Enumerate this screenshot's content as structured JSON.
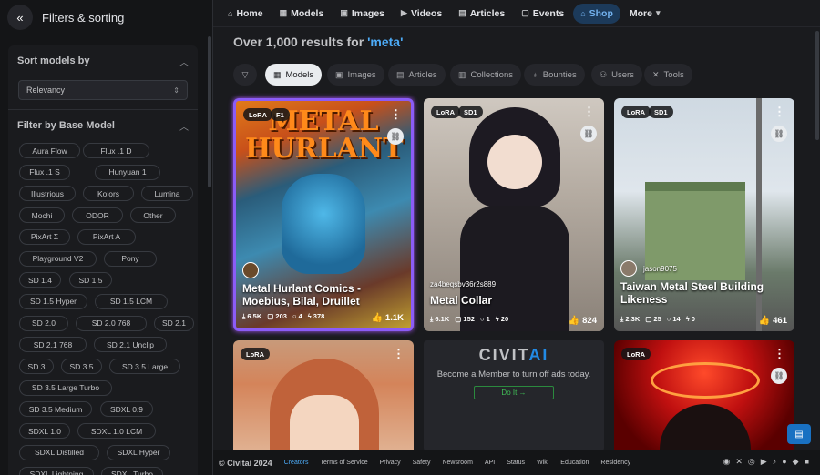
{
  "sidebar": {
    "title": "Filters & sorting",
    "sort_title": "Sort models by",
    "sort_value": "Relevancy",
    "base_model_title": "Filter by Base Model",
    "chips": [
      "Aura Flow",
      "Flux .1 D",
      "Flux .1 S",
      "Hunyuan 1",
      "Illustrious",
      "Kolors",
      "Lumina",
      "Mochi",
      "ODOR",
      "Other",
      "PixArt Σ",
      "PixArt A",
      "Playground V2",
      "Pony",
      "SD 1.4",
      "SD 1.5",
      "SD 1.5 Hyper",
      "SD 1.5 LCM",
      "SD 2.0",
      "SD 2.0 768",
      "SD 2.1",
      "SD 2.1 768",
      "SD 2.1 Unclip",
      "SD 3",
      "SD 3.5",
      "SD 3.5 Large",
      "SD 3.5 Large Turbo",
      "SD 3.5 Medium",
      "SDXL 0.9",
      "SDXL 1.0",
      "SDXL 1.0 LCM",
      "SDXL Distilled",
      "SDXL Hyper",
      "SDXL Lightning",
      "SDXL Turbo"
    ]
  },
  "nav": {
    "items": [
      "Home",
      "Models",
      "Images",
      "Videos",
      "Articles",
      "Events",
      "Shop",
      "More"
    ],
    "active": "Shop"
  },
  "results": {
    "prefix": "Over 1,000 results for ",
    "query": "'meta'"
  },
  "filters": [
    "Models",
    "Images",
    "Articles",
    "Collections",
    "Bounties",
    "Users",
    "Tools"
  ],
  "cards": [
    {
      "badges": [
        "LoRA",
        "F1"
      ],
      "title": "Metal Hurlant Comics - Moebius, Bilal, Druillet",
      "user": "",
      "stats": [
        "6.5K",
        "203",
        "4",
        "378"
      ],
      "likes": "1.1K"
    },
    {
      "badges": [
        "LoRA",
        "SD1"
      ],
      "title": "Metal Collar",
      "user": "za4beqsbv36r2s889",
      "stats": [
        "6.1K",
        "152",
        "1",
        "20"
      ],
      "likes": "824"
    },
    {
      "badges": [
        "LoRA",
        "SD1"
      ],
      "title": "Taiwan Metal Steel Building Likeness",
      "user": "jason9075",
      "stats": [
        "2.3K",
        "25",
        "14",
        "0"
      ],
      "likes": "461"
    },
    {
      "badges": [
        "LoRA"
      ]
    },
    {
      "badges": [
        "LoRA"
      ]
    }
  ],
  "ad": {
    "logo_a": "CIVIT",
    "logo_b": "AI",
    "text": "Become a Member to turn off ads today.",
    "button": "Do It"
  },
  "footer": {
    "copyright": "© Civitai 2024",
    "links": [
      "Creators",
      "Terms of Service",
      "Privacy",
      "Safety",
      "Newsroom",
      "API",
      "Status",
      "Wiki",
      "Education",
      "Residency"
    ]
  },
  "colors": {
    "accent": "#4dabf7",
    "active_nav_bg": "#1c3a5a",
    "like": "#fab005"
  }
}
